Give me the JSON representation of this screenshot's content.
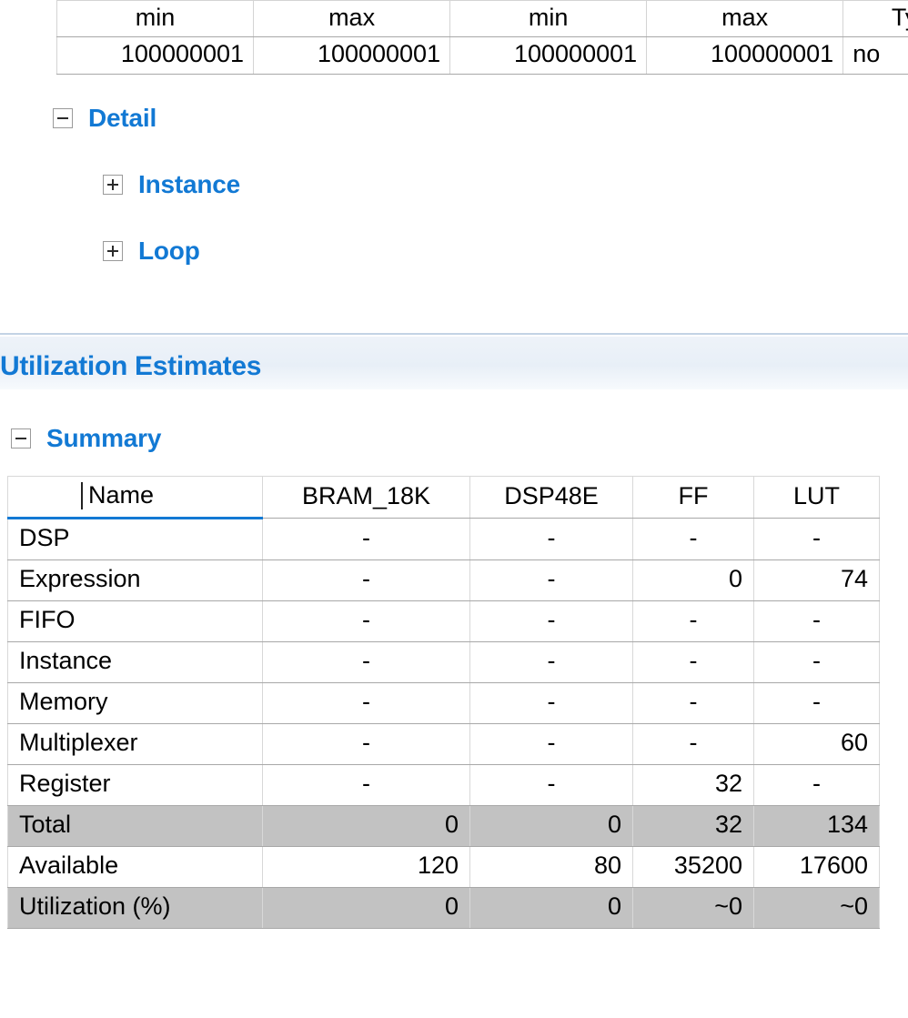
{
  "top_table": {
    "headers": [
      "min",
      "max",
      "min",
      "max",
      "Ty"
    ],
    "row": [
      "100000001",
      "100000001",
      "100000001",
      "100000001",
      "no"
    ]
  },
  "detail_tree": {
    "nodes": [
      {
        "label": "Detail",
        "toggle": "minus-icon",
        "level": 1
      },
      {
        "label": "Instance",
        "toggle": "plus-icon",
        "level": 2
      },
      {
        "label": "Loop",
        "toggle": "plus-icon",
        "level": 2
      }
    ]
  },
  "utilization": {
    "banner_title": "Utilization Estimates",
    "summary_label": "Summary",
    "summary_toggle": "minus-icon",
    "columns": [
      "Name",
      "BRAM_18K",
      "DSP48E",
      "FF",
      "LUT"
    ],
    "rows": [
      {
        "name": "DSP",
        "BRAM_18K": "-",
        "DSP48E": "-",
        "FF": "-",
        "LUT": "-",
        "shaded": false
      },
      {
        "name": "Expression",
        "BRAM_18K": "-",
        "DSP48E": "-",
        "FF": "0",
        "LUT": "74",
        "shaded": false
      },
      {
        "name": "FIFO",
        "BRAM_18K": "-",
        "DSP48E": "-",
        "FF": "-",
        "LUT": "-",
        "shaded": false
      },
      {
        "name": "Instance",
        "BRAM_18K": "-",
        "DSP48E": "-",
        "FF": "-",
        "LUT": "-",
        "shaded": false
      },
      {
        "name": "Memory",
        "BRAM_18K": "-",
        "DSP48E": "-",
        "FF": "-",
        "LUT": "-",
        "shaded": false
      },
      {
        "name": "Multiplexer",
        "BRAM_18K": "-",
        "DSP48E": "-",
        "FF": "-",
        "LUT": "60",
        "shaded": false
      },
      {
        "name": "Register",
        "BRAM_18K": "-",
        "DSP48E": "-",
        "FF": "32",
        "LUT": "-",
        "shaded": false
      },
      {
        "name": "Total",
        "BRAM_18K": "0",
        "DSP48E": "0",
        "FF": "32",
        "LUT": "134",
        "shaded": true
      },
      {
        "name": "Available",
        "BRAM_18K": "120",
        "DSP48E": "80",
        "FF": "35200",
        "LUT": "17600",
        "shaded": false
      },
      {
        "name": "Utilization (%)",
        "BRAM_18K": "0",
        "DSP48E": "0",
        "FF": "~0",
        "LUT": "~0",
        "shaded": true
      }
    ]
  },
  "colors": {
    "heading_blue": "#1279d4",
    "sorted_underline": "#1279d4",
    "shaded_row": "#c2c2c2",
    "grid_line": "#d8d8d8",
    "banner_gradient_top": "#eef3f9"
  }
}
